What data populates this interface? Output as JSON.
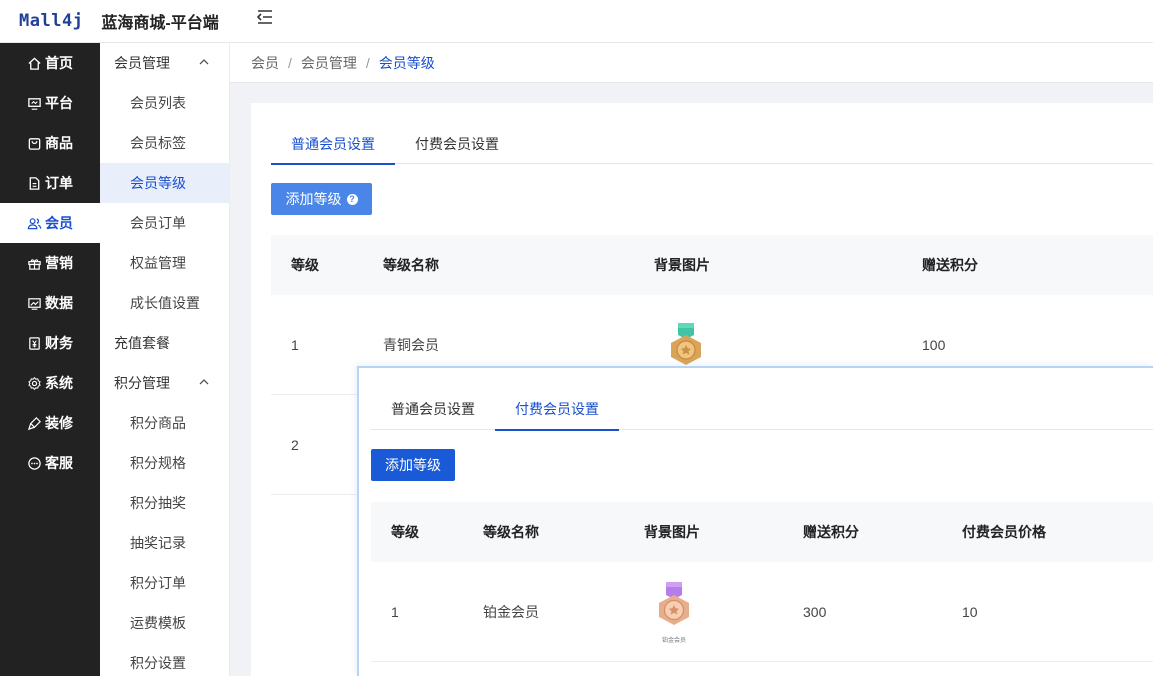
{
  "header": {
    "logo": "Mall4j",
    "title": "蓝海商城-平台端"
  },
  "nav": [
    {
      "label": "首页",
      "icon": "home-icon"
    },
    {
      "label": "平台",
      "icon": "monitor-icon"
    },
    {
      "label": "商品",
      "icon": "bag-icon"
    },
    {
      "label": "订单",
      "icon": "document-icon"
    },
    {
      "label": "会员",
      "icon": "users-icon",
      "active": true
    },
    {
      "label": "营销",
      "icon": "gift-icon"
    },
    {
      "label": "数据",
      "icon": "chart-icon"
    },
    {
      "label": "财务",
      "icon": "yen-icon"
    },
    {
      "label": "系统",
      "icon": "gear-icon"
    },
    {
      "label": "装修",
      "icon": "brush-icon"
    },
    {
      "label": "客服",
      "icon": "chat-icon"
    }
  ],
  "subnav": {
    "group1": "会员管理",
    "group1_items": [
      "会员列表",
      "会员标签",
      "会员等级",
      "会员订单",
      "权益管理",
      "成长值设置"
    ],
    "standalone": "充值套餐",
    "group2": "积分管理",
    "group2_items": [
      "积分商品",
      "积分规格",
      "积分抽奖",
      "抽奖记录",
      "积分订单",
      "运费模板",
      "积分设置"
    ]
  },
  "breadcrumb": [
    "会员",
    "会员管理",
    "会员等级"
  ],
  "main": {
    "tabs": [
      "普通会员设置",
      "付费会员设置"
    ],
    "add_label": "添加等级",
    "help_mark": "?",
    "columns": [
      "等级",
      "等级名称",
      "背景图片",
      "赠送积分"
    ],
    "rows": [
      {
        "level": "1",
        "name": "青铜会员",
        "points": "100"
      },
      {
        "level": "2",
        "name": "",
        "points": ""
      }
    ]
  },
  "popup": {
    "tabs": [
      "普通会员设置",
      "付费会员设置"
    ],
    "add_label": "添加等级",
    "columns": [
      "等级",
      "等级名称",
      "背景图片",
      "赠送积分",
      "付费会员价格"
    ],
    "rows": [
      {
        "level": "1",
        "name": "铂金会员",
        "points": "300",
        "price": "10",
        "medal_caption": "铂金会员"
      }
    ]
  },
  "colors": {
    "accent": "#1a4fce",
    "nav_bg": "#222222",
    "button": "#4a86e8"
  }
}
